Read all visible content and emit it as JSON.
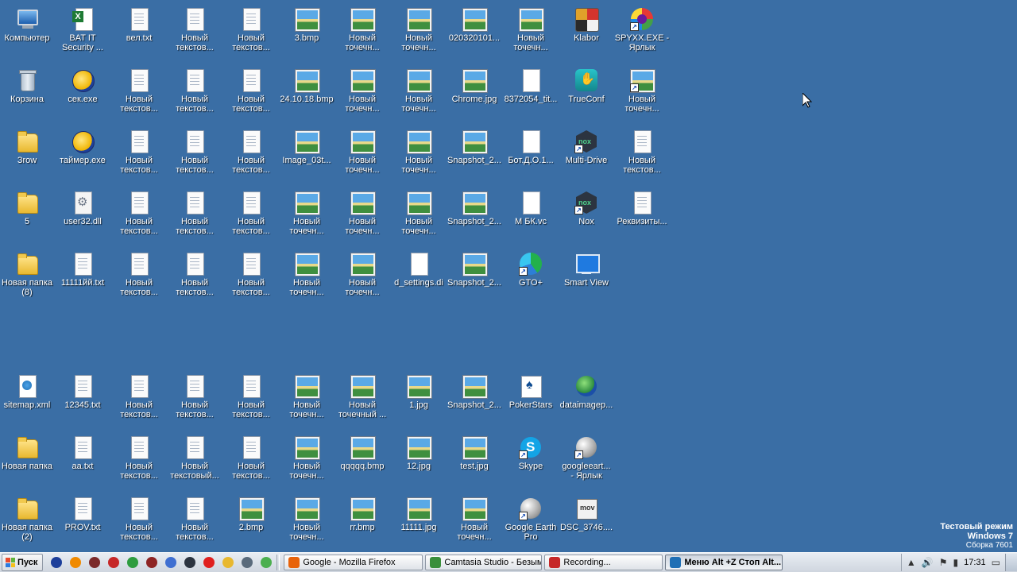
{
  "desktop": {
    "icons": [
      {
        "label": "Компьютер",
        "kind": "computer",
        "icon": "computer-icon"
      },
      {
        "label": "BAT IT\nSecurity ...",
        "kind": "excel",
        "icon": "excel-file-icon"
      },
      {
        "label": "вел.txt",
        "kind": "txt",
        "icon": "text-file-icon"
      },
      {
        "label": "Новый\nтекстов...",
        "kind": "txt",
        "icon": "text-file-icon"
      },
      {
        "label": "Новый\nтекстов...",
        "kind": "txt",
        "icon": "text-file-icon"
      },
      {
        "label": "3.bmp",
        "kind": "img",
        "icon": "image-file-icon"
      },
      {
        "label": "Новый\nточечн...",
        "kind": "img",
        "icon": "image-file-icon"
      },
      {
        "label": "Новый\nточечн...",
        "kind": "img",
        "icon": "image-file-icon"
      },
      {
        "label": "020320101...",
        "kind": "img",
        "icon": "image-file-icon"
      },
      {
        "label": "Новый\nточечн...",
        "kind": "img",
        "icon": "image-file-icon"
      },
      {
        "label": "Klabor",
        "kind": "app-klabor",
        "icon": "klabor-icon"
      },
      {
        "label": "SPYXX.EXE -\nЯрлык",
        "kind": "app-spy",
        "icon": "spyxx-icon",
        "shortcut": true
      },
      {
        "label": "Корзина",
        "kind": "bin",
        "icon": "recycle-bin-icon"
      },
      {
        "label": "сек.exe",
        "kind": "globe",
        "icon": "exe-app-icon"
      },
      {
        "label": "Новый\nтекстов...",
        "kind": "txt",
        "icon": "text-file-icon"
      },
      {
        "label": "Новый\nтекстов...",
        "kind": "txt",
        "icon": "text-file-icon"
      },
      {
        "label": "Новый\nтекстов...",
        "kind": "txt",
        "icon": "text-file-icon"
      },
      {
        "label": "24.10.18.bmp",
        "kind": "img",
        "icon": "image-file-icon"
      },
      {
        "label": "Новый\nточечн...",
        "kind": "img",
        "icon": "image-file-icon"
      },
      {
        "label": "Новый\nточечн...",
        "kind": "img",
        "icon": "image-file-icon"
      },
      {
        "label": "Chrome.jpg",
        "kind": "img",
        "icon": "image-file-icon"
      },
      {
        "label": "8372054_tit...",
        "kind": "blank",
        "icon": "blank-file-icon"
      },
      {
        "label": "TrueConf",
        "kind": "trueconf",
        "icon": "trueconf-icon"
      },
      {
        "label": "Новый\nточечн...",
        "kind": "img",
        "icon": "image-file-icon",
        "shortcut": true
      },
      {
        "label": "Зrow",
        "kind": "folder",
        "icon": "folder-icon"
      },
      {
        "label": "таймер.exe",
        "kind": "globe",
        "icon": "exe-app-icon"
      },
      {
        "label": "Новый\nтекстов...",
        "kind": "txt",
        "icon": "text-file-icon"
      },
      {
        "label": "Новый\nтекстов...",
        "kind": "txt",
        "icon": "text-file-icon"
      },
      {
        "label": "Новый\nтекстов...",
        "kind": "txt",
        "icon": "text-file-icon"
      },
      {
        "label": "Image_03t...",
        "kind": "img",
        "icon": "image-file-icon"
      },
      {
        "label": "Новый\nточечн...",
        "kind": "img",
        "icon": "image-file-icon"
      },
      {
        "label": "Новый\nточечн...",
        "kind": "img",
        "icon": "image-file-icon"
      },
      {
        "label": "Snapshot_2...",
        "kind": "img",
        "icon": "image-file-icon"
      },
      {
        "label": "Бот.Д.О.1...",
        "kind": "blank",
        "icon": "blank-file-icon"
      },
      {
        "label": "Multi-Drive",
        "kind": "hex",
        "icon": "multi-drive-icon",
        "shortcut": true
      },
      {
        "label": "Новый\nтекстов...",
        "kind": "txt",
        "icon": "text-file-icon"
      },
      {
        "label": "5",
        "kind": "folder",
        "icon": "folder-icon"
      },
      {
        "label": "user32.dll",
        "kind": "dll",
        "icon": "dll-file-icon"
      },
      {
        "label": "Новый\nтекстов...",
        "kind": "txt",
        "icon": "text-file-icon"
      },
      {
        "label": "Новый\nтекстов...",
        "kind": "txt",
        "icon": "text-file-icon"
      },
      {
        "label": "Новый\nтекстов...",
        "kind": "txt",
        "icon": "text-file-icon"
      },
      {
        "label": "Новый\nточечн...",
        "kind": "img",
        "icon": "image-file-icon"
      },
      {
        "label": "Новый\nточечн...",
        "kind": "img",
        "icon": "image-file-icon"
      },
      {
        "label": "Новый\nточечн...",
        "kind": "img",
        "icon": "image-file-icon"
      },
      {
        "label": "Snapshot_2...",
        "kind": "img",
        "icon": "image-file-icon"
      },
      {
        "label": "М БК.vc",
        "kind": "blank",
        "icon": "blank-file-icon"
      },
      {
        "label": "Nox",
        "kind": "hex",
        "icon": "nox-icon",
        "shortcut": true
      },
      {
        "label": "Реквизиты...",
        "kind": "txt",
        "icon": "text-file-icon"
      },
      {
        "label": "Новая папка\n(8)",
        "kind": "folder",
        "icon": "folder-icon"
      },
      {
        "label": "11111йй.txt",
        "kind": "txt",
        "icon": "text-file-icon"
      },
      {
        "label": "Новый\nтекстов...",
        "kind": "txt",
        "icon": "text-file-icon"
      },
      {
        "label": "Новый\nтекстов...",
        "kind": "txt",
        "icon": "text-file-icon"
      },
      {
        "label": "Новый\nтекстов...",
        "kind": "txt",
        "icon": "text-file-icon"
      },
      {
        "label": "Новый\nточечн...",
        "kind": "img",
        "icon": "image-file-icon"
      },
      {
        "label": "Новый\nточечн...",
        "kind": "img",
        "icon": "image-file-icon"
      },
      {
        "label": "d_settings.di",
        "kind": "blank",
        "icon": "blank-file-icon"
      },
      {
        "label": "Snapshot_2...",
        "kind": "img",
        "icon": "image-file-icon"
      },
      {
        "label": "GTO+",
        "kind": "gto",
        "icon": "gto-icon",
        "shortcut": true
      },
      {
        "label": "Smart View",
        "kind": "smart",
        "icon": "smart-view-icon"
      },
      {
        "label": "sitemap.xml",
        "kind": "xml",
        "icon": "xml-file-icon"
      },
      {
        "label": "12345.txt",
        "kind": "txt",
        "icon": "text-file-icon"
      },
      {
        "label": "Новый\nтекстов...",
        "kind": "txt",
        "icon": "text-file-icon"
      },
      {
        "label": "Новый\nтекстов...",
        "kind": "txt",
        "icon": "text-file-icon"
      },
      {
        "label": "Новый\nтекстов...",
        "kind": "txt",
        "icon": "text-file-icon"
      },
      {
        "label": "Новый\nточечн...",
        "kind": "img",
        "icon": "image-file-icon"
      },
      {
        "label": "Новый\nточечный ...",
        "kind": "img",
        "icon": "image-file-icon"
      },
      {
        "label": "1.jpg",
        "kind": "img",
        "icon": "image-file-icon"
      },
      {
        "label": "Snapshot_2...",
        "kind": "img",
        "icon": "image-file-icon"
      },
      {
        "label": "PokerStars",
        "kind": "poker",
        "icon": "pokerstars-icon"
      },
      {
        "label": "dataimagep...",
        "kind": "dataimg",
        "icon": "dataimage-icon"
      },
      {
        "label": "Новая папка",
        "kind": "folder",
        "icon": "folder-icon"
      },
      {
        "label": "aa.txt",
        "kind": "txt",
        "icon": "text-file-icon"
      },
      {
        "label": "Новый\nтекстов...",
        "kind": "txt",
        "icon": "text-file-icon"
      },
      {
        "label": "Новый\nтекстовый...",
        "kind": "txt",
        "icon": "text-file-icon"
      },
      {
        "label": "Новый\nтекстов...",
        "kind": "txt",
        "icon": "text-file-icon"
      },
      {
        "label": "Новый\nточечн...",
        "kind": "img",
        "icon": "image-file-icon"
      },
      {
        "label": "qqqqq.bmp",
        "kind": "img",
        "icon": "image-file-icon"
      },
      {
        "label": "12.jpg",
        "kind": "img",
        "icon": "image-file-icon"
      },
      {
        "label": "test.jpg",
        "kind": "img",
        "icon": "image-file-icon"
      },
      {
        "label": "Skype",
        "kind": "skype",
        "icon": "skype-icon",
        "shortcut": true
      },
      {
        "label": "googleeart...\n- Ярлык",
        "kind": "earth",
        "icon": "google-earth-icon",
        "shortcut": true
      },
      {
        "label": "Новая папка\n(2)",
        "kind": "folder",
        "icon": "folder-icon"
      },
      {
        "label": "PROV.txt",
        "kind": "txt",
        "icon": "text-file-icon"
      },
      {
        "label": "Новый\nтекстов...",
        "kind": "txt",
        "icon": "text-file-icon"
      },
      {
        "label": "Новый\nтекстов...",
        "kind": "txt",
        "icon": "text-file-icon"
      },
      {
        "label": "2.bmp",
        "kind": "img",
        "icon": "image-file-icon"
      },
      {
        "label": "Новый\nточечн...",
        "kind": "img",
        "icon": "image-file-icon"
      },
      {
        "label": "rr.bmp",
        "kind": "img",
        "icon": "image-file-icon"
      },
      {
        "label": "11111.jpg",
        "kind": "img",
        "icon": "image-file-icon"
      },
      {
        "label": "Новый\nточечн...",
        "kind": "img",
        "icon": "image-file-icon"
      },
      {
        "label": "Google Earth\nPro",
        "kind": "earth",
        "icon": "google-earth-icon",
        "shortcut": true
      },
      {
        "label": "DSC_3746....",
        "kind": "mov",
        "icon": "video-file-icon"
      }
    ]
  },
  "watermark": {
    "line1": "Тестовый режим",
    "line2": "Windows 7",
    "line3": "Сборка 7601"
  },
  "taskbar": {
    "start_label": "Пуск",
    "quicklaunch": [
      {
        "icon": "globe-app-icon",
        "color": "#1d3f9a"
      },
      {
        "icon": "media-player-icon",
        "color": "#f08a00"
      },
      {
        "icon": "infinity-app-icon",
        "color": "#7b2a2a"
      },
      {
        "icon": "spy-app-icon",
        "color": "#c62828"
      },
      {
        "icon": "chrome-icon",
        "color": "#2e9c3f"
      },
      {
        "icon": "loop-app-icon",
        "color": "#8e2424"
      },
      {
        "icon": "network-icon",
        "color": "#3f6fd1"
      },
      {
        "icon": "nox-icon",
        "color": "#2c3440"
      },
      {
        "icon": "opera-icon",
        "color": "#e0201f"
      },
      {
        "icon": "folder-icon",
        "color": "#e8b830"
      },
      {
        "icon": "pen-icon",
        "color": "#5a6b7c"
      },
      {
        "icon": "check-app-icon",
        "color": "#4caf50"
      }
    ],
    "windows": [
      {
        "label": "Google - Mozilla Firefox",
        "icon": "firefox-icon",
        "color": "#e8630a",
        "active": false
      },
      {
        "label": "Camtasia Studio - Безым...",
        "icon": "camtasia-icon",
        "color": "#3b8f3b",
        "active": false
      },
      {
        "label": "Recording...",
        "icon": "recording-icon",
        "color": "#c62828",
        "active": false
      },
      {
        "label": "Меню Alt +Z Стоп Alt...",
        "icon": "app-window-icon",
        "color": "#1f6fb5",
        "active": true
      }
    ],
    "clock": "17:31"
  },
  "colors": {
    "desktop": "#3a6ea5",
    "taskbar": "#d7dde5"
  }
}
